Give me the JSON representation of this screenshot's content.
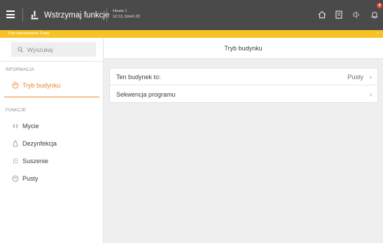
{
  "topbar": {
    "stop_label": "Wstrzymaj funkcje",
    "house_name": "House 1",
    "datetime": "12:13, Dzień 23",
    "notification_count": "4",
    "icons": [
      "home-icon",
      "document-icon",
      "sound-icon",
      "bell-icon"
    ]
  },
  "status": {
    "text": "Tryb wstrzymania: Pusty",
    "accent": "#f7c324"
  },
  "sidebar": {
    "search_placeholder": "Wyszukaj",
    "section_info": "INFORMACJA",
    "section_functions": "FUNKCJE",
    "items": [
      {
        "label": "Tryb budynku",
        "icon": "house-mode-icon",
        "active": true
      },
      {
        "label": "Mycie",
        "icon": "washing-icon"
      },
      {
        "label": "Dezynfekcja",
        "icon": "disinfection-icon"
      },
      {
        "label": "Suszenie",
        "icon": "drying-icon"
      },
      {
        "label": "Pusty",
        "icon": "empty-icon"
      }
    ]
  },
  "main": {
    "title": "Tryb budynku",
    "rows": [
      {
        "label": "Ten budynek to:",
        "value": "Pusty"
      },
      {
        "label": "Sekwencja programu",
        "value": ""
      }
    ]
  },
  "colors": {
    "topbar": "#4a4a4a",
    "active": "#e8872a",
    "badge": "#e64a2e"
  }
}
